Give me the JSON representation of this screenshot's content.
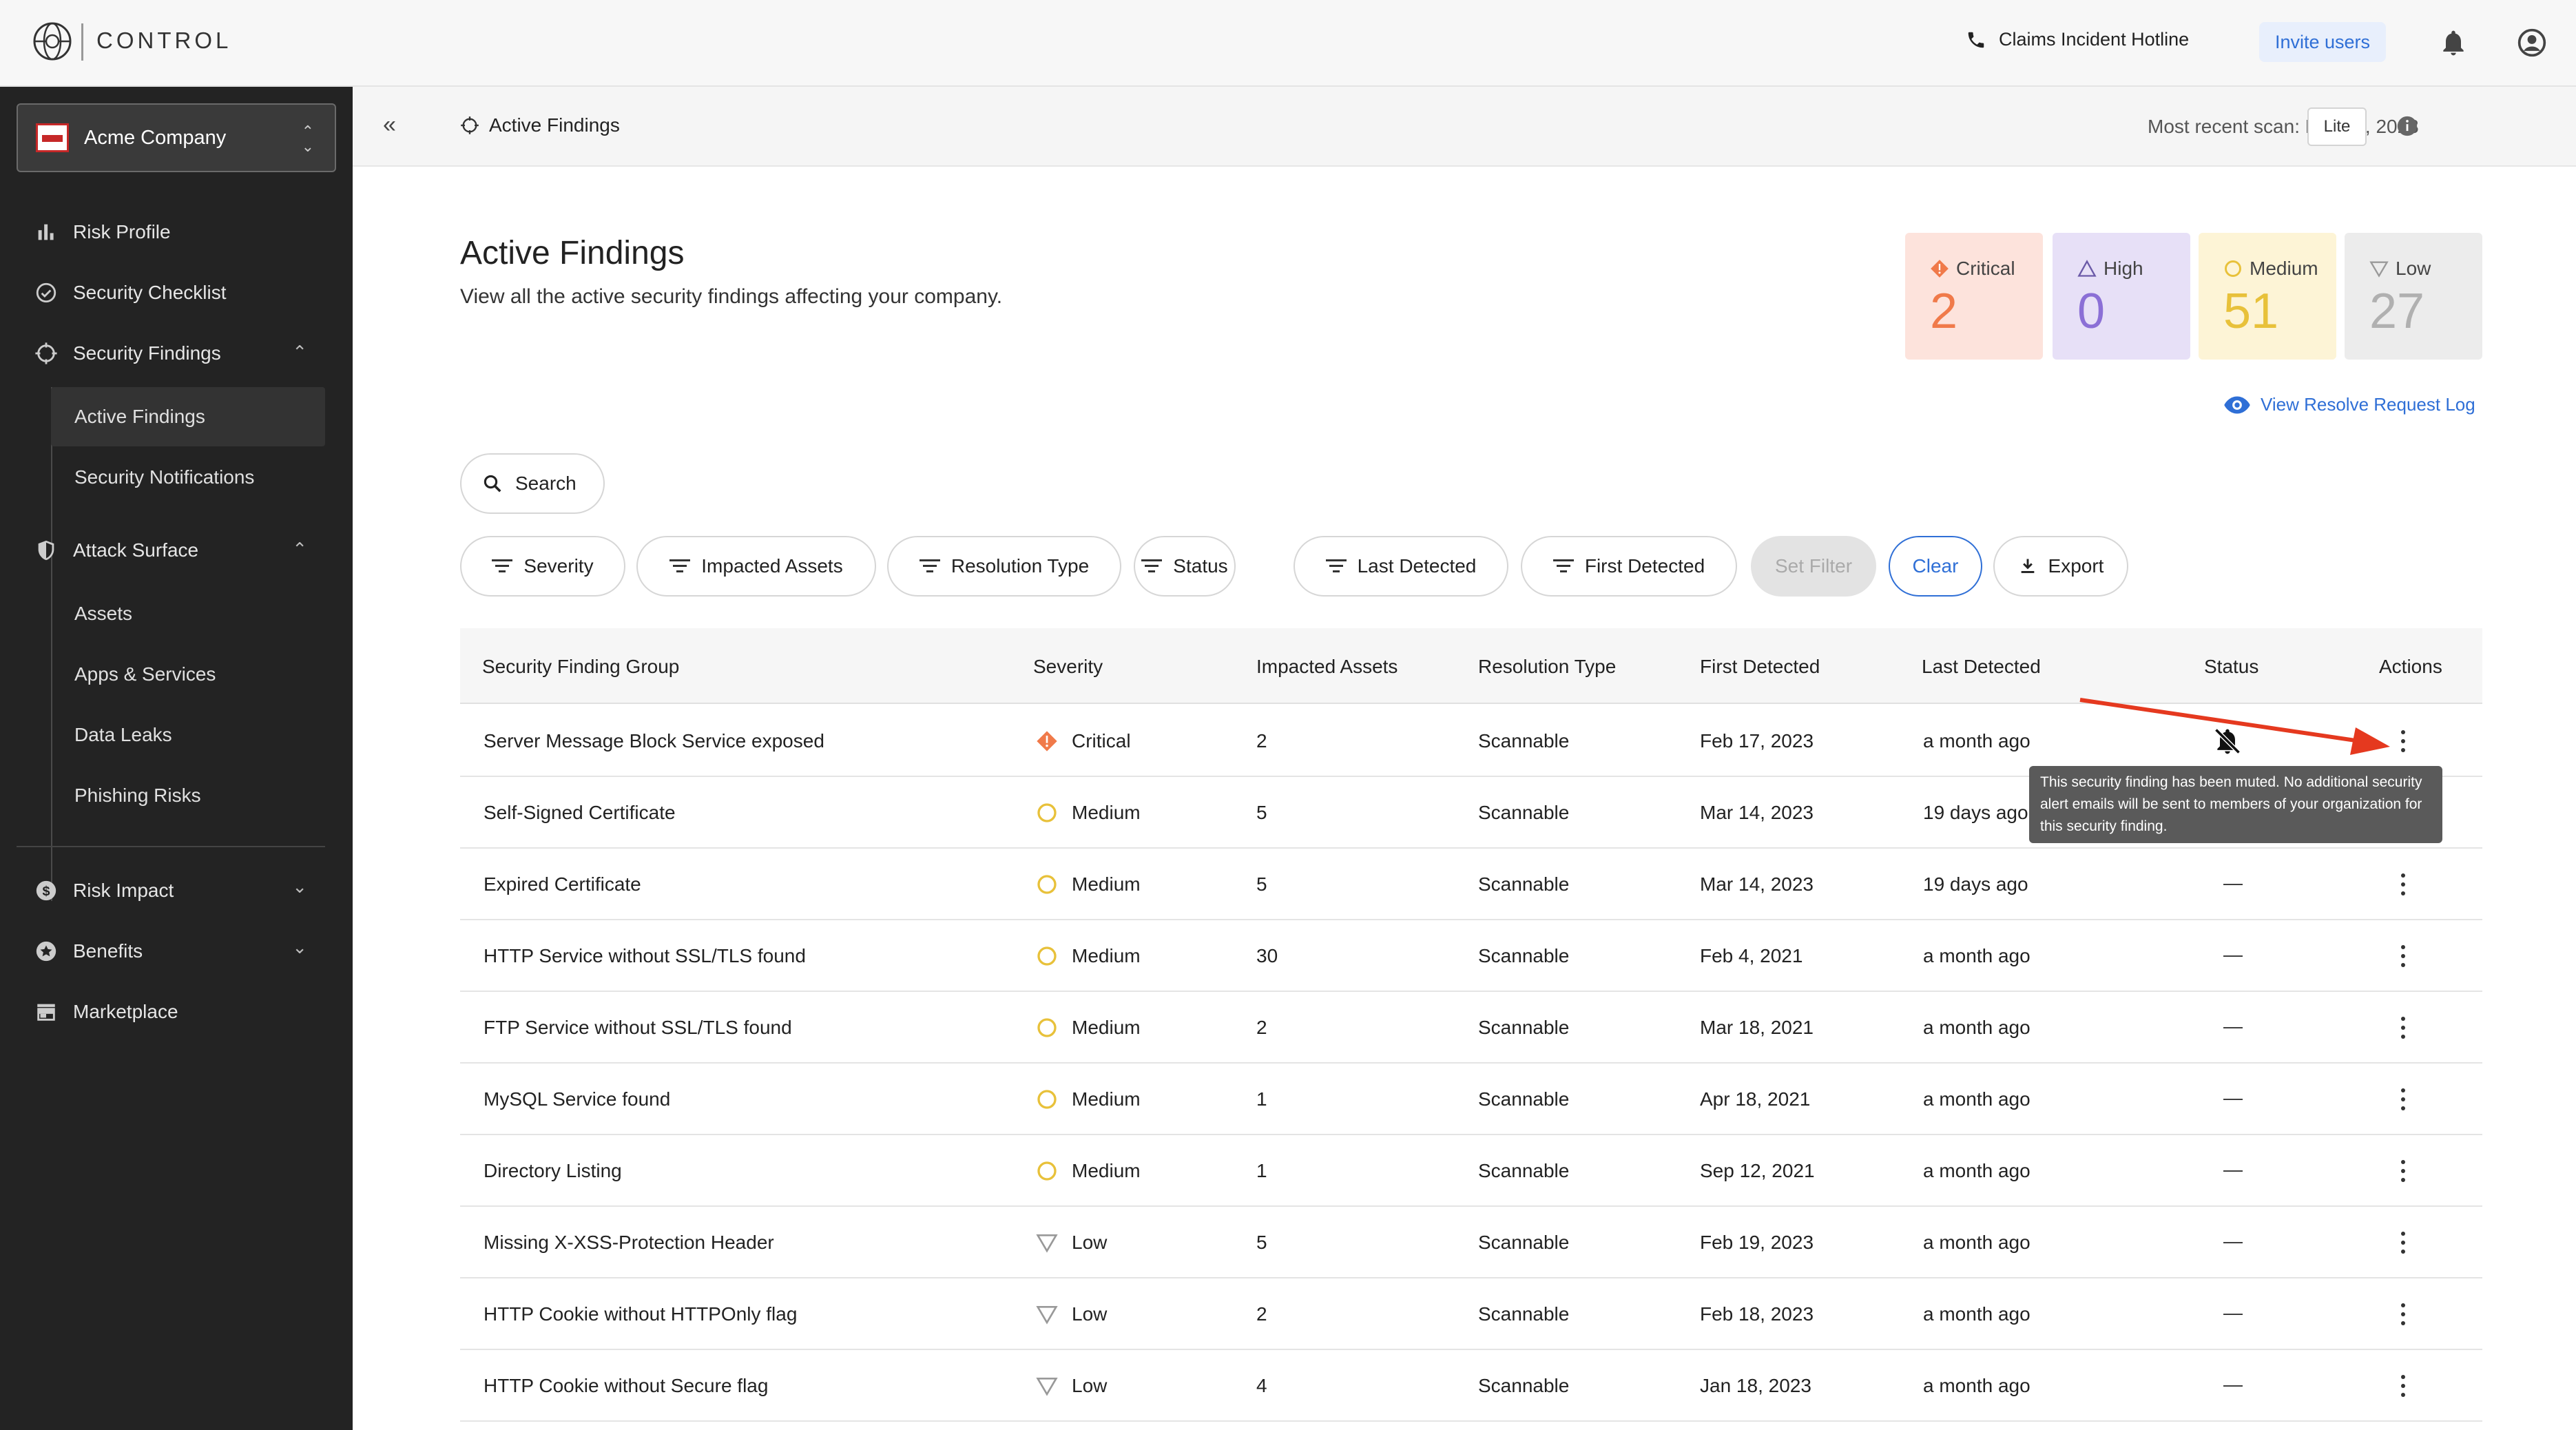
{
  "topbar": {
    "brand": "CONTROL",
    "hotline": "Claims Incident Hotline",
    "invite": "Invite users"
  },
  "sidebar": {
    "company": "Acme Company",
    "items": {
      "risk_profile": "Risk Profile",
      "security_checklist": "Security Checklist",
      "security_findings": "Security Findings",
      "active_findings": "Active Findings",
      "security_notifications": "Security Notifications",
      "attack_surface": "Attack Surface",
      "assets": "Assets",
      "apps_services": "Apps & Services",
      "data_leaks": "Data Leaks",
      "phishing_risks": "Phishing Risks",
      "risk_impact": "Risk Impact",
      "benefits": "Benefits",
      "marketplace": "Marketplace"
    }
  },
  "pagebar": {
    "breadcrumb": "Active Findings",
    "scan": "Most recent scan: Mar 17, 2023",
    "mode": "Lite"
  },
  "main": {
    "title": "Active Findings",
    "subtitle": "View all the active security findings affecting your company.",
    "severity_cards": {
      "critical": {
        "label": "Critical",
        "count": "2",
        "color": "#f07a4a"
      },
      "high": {
        "label": "High",
        "count": "0",
        "color": "#8b6fd6"
      },
      "medium": {
        "label": "Medium",
        "count": "51",
        "color": "#e8c13a"
      },
      "low": {
        "label": "Low",
        "count": "27",
        "color": "#b0b0b0"
      }
    },
    "resolve_log": "View Resolve Request Log",
    "search": "Search",
    "filters": {
      "severity": "Severity",
      "impacted_assets": "Impacted Assets",
      "resolution_type": "Resolution Type",
      "status": "Status",
      "last_detected": "Last Detected",
      "first_detected": "First Detected",
      "set_filter": "Set Filter",
      "clear": "Clear",
      "export": "Export"
    }
  },
  "table": {
    "headers": {
      "group": "Security Finding Group",
      "severity": "Severity",
      "impacted": "Impacted Assets",
      "resolution": "Resolution Type",
      "first": "First Detected",
      "last": "Last Detected",
      "status": "Status",
      "actions": "Actions"
    },
    "rows": [
      {
        "group": "Server Message Block Service exposed",
        "severity": "Critical",
        "impacted": "2",
        "resolution": "Scannable",
        "first": "Feb 17, 2023",
        "last": "a month ago",
        "status": "muted"
      },
      {
        "group": "Self-Signed Certificate",
        "severity": "Medium",
        "impacted": "5",
        "resolution": "Scannable",
        "first": "Mar 14, 2023",
        "last": "19 days ago",
        "status": ""
      },
      {
        "group": "Expired Certificate",
        "severity": "Medium",
        "impacted": "5",
        "resolution": "Scannable",
        "first": "Mar 14, 2023",
        "last": "19 days ago",
        "status": "—"
      },
      {
        "group": "HTTP Service without SSL/TLS found",
        "severity": "Medium",
        "impacted": "30",
        "resolution": "Scannable",
        "first": "Feb 4, 2021",
        "last": "a month ago",
        "status": "—"
      },
      {
        "group": "FTP Service without SSL/TLS found",
        "severity": "Medium",
        "impacted": "2",
        "resolution": "Scannable",
        "first": "Mar 18, 2021",
        "last": "a month ago",
        "status": "—"
      },
      {
        "group": "MySQL Service found",
        "severity": "Medium",
        "impacted": "1",
        "resolution": "Scannable",
        "first": "Apr 18, 2021",
        "last": "a month ago",
        "status": "—"
      },
      {
        "group": "Directory Listing",
        "severity": "Medium",
        "impacted": "1",
        "resolution": "Scannable",
        "first": "Sep 12, 2021",
        "last": "a month ago",
        "status": "—"
      },
      {
        "group": "Missing X-XSS-Protection Header",
        "severity": "Low",
        "impacted": "5",
        "resolution": "Scannable",
        "first": "Feb 19, 2023",
        "last": "a month ago",
        "status": "—"
      },
      {
        "group": "HTTP Cookie without HTTPOnly flag",
        "severity": "Low",
        "impacted": "2",
        "resolution": "Scannable",
        "first": "Feb 18, 2023",
        "last": "a month ago",
        "status": "—"
      },
      {
        "group": "HTTP Cookie without Secure flag",
        "severity": "Low",
        "impacted": "4",
        "resolution": "Scannable",
        "first": "Jan 18, 2023",
        "last": "a month ago",
        "status": "—"
      }
    ]
  },
  "tooltip": {
    "text": "This security finding has been muted. No additional security alert emails will be sent to members of your organization for this security finding."
  },
  "icons": {
    "logo": "control-logo-icon",
    "phone": "phone-icon",
    "bell": "bell-icon",
    "account": "account-icon",
    "mute": "bell-off-icon",
    "kebab": "kebab-menu-icon",
    "eye": "eye-icon",
    "export": "download-icon"
  }
}
